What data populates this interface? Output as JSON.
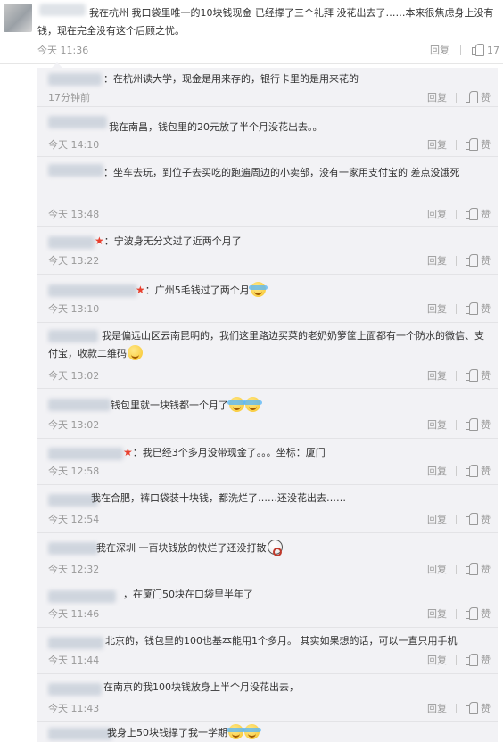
{
  "main_comment": {
    "text": "我在杭州 我口袋里唯一的10块钱现金 已经撑了三个礼拜 没花出去了……本来很焦虑身上没有钱，现在完全没有这个后顾之忧。",
    "time": "今天 11:36",
    "reply_label": "回复",
    "like_count": "17"
  },
  "replies": [
    {
      "text": "在杭州读大学，现金是用来存的，银行卡里的是用来花的",
      "time": "17分钟前",
      "reply_label": "回复",
      "like_label": "赞"
    },
    {
      "text": "我在南昌，钱包里的20元放了半个月没花出去。。",
      "time": "今天 14:10",
      "reply_label": "回复",
      "like_label": "赞"
    },
    {
      "text": "坐车去玩，到位子去买吃的跑遍周边的小卖部，没有一家用支付宝的   差点没饿死",
      "time": "今天 13:48",
      "reply_label": "回复",
      "like_label": "赞"
    },
    {
      "text": "宁波身无分文过了近两个月了",
      "time": "今天 13:22",
      "reply_label": "回复",
      "like_label": "赞"
    },
    {
      "text": "广州5毛钱过了两个月",
      "time": "今天 13:10",
      "reply_label": "回复",
      "like_label": "赞"
    },
    {
      "text": "我是偏远山区云南昆明的，我们这里路边买菜的老奶奶箩筐上面都有一个防水的微信、支付宝，收款二维码",
      "time": "今天 13:02",
      "reply_label": "回复",
      "like_label": "赞"
    },
    {
      "text": "钱包里就一块钱都一个月了",
      "time": "今天 13:02",
      "reply_label": "回复",
      "like_label": "赞"
    },
    {
      "text": "我已经3个多月没带现金了。。。坐标：厦门",
      "time": "今天 12:58",
      "reply_label": "回复",
      "like_label": "赞"
    },
    {
      "text": "我在合肥，裤口袋装十块钱，都洗烂了……还没花出去……",
      "time": "今天 12:54",
      "reply_label": "回复",
      "like_label": "赞"
    },
    {
      "text": "我在深圳  一百块钱放的快烂了还没打散",
      "time": "今天 12:32",
      "reply_label": "回复",
      "like_label": "赞"
    },
    {
      "text": "在厦门50块在口袋里半年了",
      "time": "今天 11:46",
      "reply_label": "回复",
      "like_label": "赞"
    },
    {
      "text": "北京的，钱包里的100也基本能用1个多月。 其实如果想的话，可以一直只用手机",
      "time": "今天 11:44",
      "reply_label": "回复",
      "like_label": "赞"
    },
    {
      "text": "在南京的我100块钱放身上半个月没花出去，",
      "time": "今天 11:43",
      "reply_label": "回复",
      "like_label": "赞"
    },
    {
      "text": "我身上50块钱撑了我一学期",
      "time": "",
      "reply_label": "",
      "like_label": ""
    }
  ]
}
